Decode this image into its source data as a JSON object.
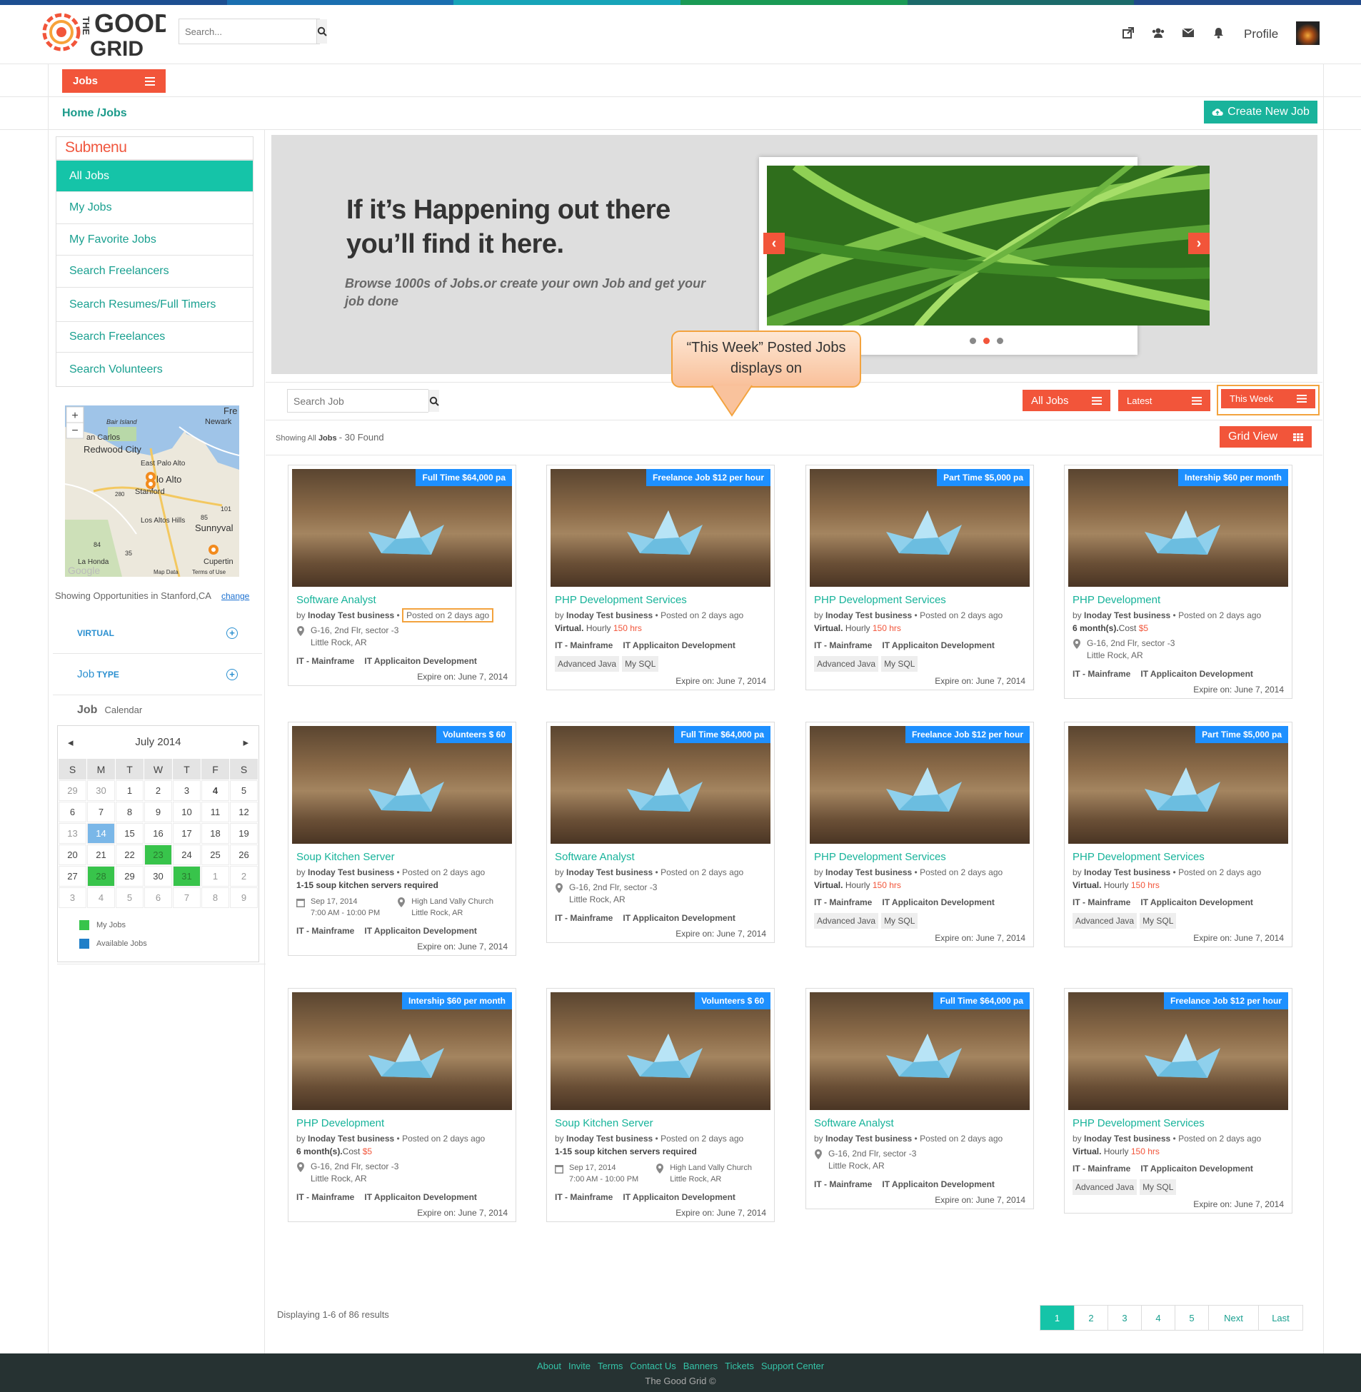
{
  "header": {
    "logo_line1": "THE",
    "logo_line2": "GOOD",
    "logo_line3": "GRID",
    "search_placeholder": "Search...",
    "profile_label": "Profile"
  },
  "jobs_menu_label": "Jobs",
  "breadcrumb": "Home /Jobs",
  "create_button": "Create New Job",
  "submenu": {
    "title": "Submenu",
    "items": [
      "All Jobs",
      "My Jobs",
      "My Favorite Jobs",
      "Search Freelancers",
      "Search Resumes/Full Timers",
      "Search Freelances",
      "Search Volunteers"
    ]
  },
  "map": {
    "labels": [
      "Fre",
      "Newark",
      "Bair Island",
      "an Carlos",
      "Redwood City",
      "East Palo Alto",
      "lo Alto",
      "Stanford",
      "Los Altos Hills",
      "Sunnyval",
      "La Honda",
      "Cupertin",
      "Map Data",
      "Terms of Use",
      "280",
      "101",
      "85",
      "84",
      "35",
      "Google"
    ],
    "zoom_in": "+",
    "zoom_out": "−"
  },
  "opportunities": {
    "text": "Showing Opportunities in Stanford,CA",
    "change": "change"
  },
  "facets": {
    "virtual": "VIRTUAL",
    "job_type_a": "Job",
    "job_type_b": "TYPE",
    "job_calendar_a": "Job",
    "job_calendar_b": "Calendar"
  },
  "calendar": {
    "prev": "◂",
    "next": "▸",
    "month": "July 2014",
    "weekdays": [
      "S",
      "M",
      "T",
      "W",
      "T",
      "F",
      "S"
    ],
    "rows": [
      [
        "29",
        "30",
        "1",
        "2",
        "3",
        "4",
        "5"
      ],
      [
        "6",
        "7",
        "8",
        "9",
        "10",
        "11",
        "12"
      ],
      [
        "13",
        "14",
        "15",
        "16",
        "17",
        "18",
        "19"
      ],
      [
        "20",
        "21",
        "22",
        "23",
        "24",
        "25",
        "26"
      ],
      [
        "27",
        "28",
        "29",
        "30",
        "31",
        "1",
        "2"
      ],
      [
        "3",
        "4",
        "5",
        "6",
        "7",
        "8",
        "9"
      ]
    ],
    "legend_my": "My Jobs",
    "legend_available": "Available Jobs",
    "colors": {
      "my_jobs": "#38c44b",
      "available": "#1f7fc8"
    }
  },
  "banner": {
    "title": "If it’s Happening out there you’ll find it here.",
    "subtitle": "Browse 1000s of Jobs.or create your own Job and get your job done",
    "prev": "‹",
    "next": "›"
  },
  "callout": "“This Week” Posted Jobs displays on",
  "jobs_toolbar": {
    "search_placeholder": "Search Job",
    "all_jobs": "All Jobs",
    "latest": "Latest",
    "this_week": "This Week",
    "showing_prefix": "Showing All",
    "showing_bold": "Jobs",
    "showing_suffix": "- 30 Found",
    "grid_view": "Grid View"
  },
  "cards": [
    {
      "tag": "Full Time $64,000 pa",
      "title": "Software Analyst",
      "by": "by",
      "biz": "Inoday Test business",
      "dot": "•",
      "posted": "Posted on 2  days ago",
      "l1": "G-16, 2nd Flr, sector -3",
      "l2": "Little Rock, AR",
      "c1": "IT - Mainframe",
      "c2": "IT Applicaiton Development",
      "exp": "Expire on: June 7, 2014"
    },
    {
      "tag": "Freelance Job   $12 per hour",
      "title": "PHP Development Services",
      "by": "by",
      "biz": "Inoday Test business",
      "dot": "•",
      "posted": "Posted on 2  days ago",
      "v1": "Virtual.",
      "v2": "Hourly",
      "v3": "150 hrs",
      "c1": "IT - Mainframe",
      "c2": "IT Applicaiton Development",
      "s1": "Advanced Java",
      "s2": "My SQL",
      "exp": "Expire on: June 7, 2014"
    },
    {
      "tag": "Part Time $5,000 pa",
      "title": "PHP Development Services",
      "by": "by",
      "biz": "Inoday Test business",
      "dot": "•",
      "posted": "Posted on 2  days ago",
      "v1": "Virtual.",
      "v2": "Hourly",
      "v3": "150 hrs",
      "c1": "IT - Mainframe",
      "c2": "IT Applicaiton Development",
      "s1": "Advanced Java",
      "s2": "My SQL",
      "exp": "Expire on: June 7, 2014"
    },
    {
      "tag": "Intership $60 per month",
      "title": "PHP Development",
      "by": "by",
      "biz": "Inoday Test business",
      "dot": "•",
      "posted": "Posted on 2  days ago",
      "m1": "6 month(s).",
      "m2": "Cost",
      "m3": "$5",
      "l1": "G-16, 2nd Flr, sector -3",
      "l2": "Little Rock, AR",
      "c1": "IT - Mainframe",
      "c2": "IT Applicaiton Development",
      "exp": "Expire on: June 7, 2014"
    },
    {
      "tag": "Volunteers  $ 60",
      "title": "Soup Kitchen Server",
      "by": "by",
      "biz": "Inoday Test business",
      "dot": "•",
      "posted": "Posted on 2  days ago",
      "k1": "1-15",
      "k2": "soup kitchen servers required",
      "d1": "Sep 17, 2014",
      "d2": "7:00 AM - 10:00 PM",
      "p1": "High Land Vally Church",
      "p2": "Little Rock, AR",
      "c1": "IT - Mainframe",
      "c2": "IT Applicaiton Development",
      "exp": "Expire on: June 7, 2014"
    },
    {
      "tag": "Full Time $64,000 pa",
      "title": "Software Analyst",
      "by": "by",
      "biz": "Inoday Test business",
      "dot": "•",
      "posted": "Posted on 2  days ago",
      "l1": "G-16, 2nd Flr, sector -3",
      "l2": "Little Rock, AR",
      "c1": "IT - Mainframe",
      "c2": "IT Applicaiton Development",
      "exp": "Expire on: June 7, 2014"
    },
    {
      "tag": "Freelance Job   $12 per hour",
      "title": "PHP Development Services",
      "by": "by",
      "biz": "Inoday Test business",
      "dot": "•",
      "posted": "Posted on 2  days ago",
      "v1": "Virtual.",
      "v2": "Hourly",
      "v3": "150 hrs",
      "c1": "IT - Mainframe",
      "c2": "IT Applicaiton Development",
      "s1": "Advanced Java",
      "s2": "My SQL",
      "exp": "Expire on: June 7, 2014"
    },
    {
      "tag": "Part Time $5,000 pa",
      "title": "PHP Development Services",
      "by": "by",
      "biz": "Inoday Test business",
      "dot": "•",
      "posted": "Posted on 2  days ago",
      "v1": "Virtual.",
      "v2": "Hourly",
      "v3": "150 hrs",
      "c1": "IT - Mainframe",
      "c2": "IT Applicaiton Development",
      "s1": "Advanced Java",
      "s2": "My SQL",
      "exp": "Expire on: June 7, 2014"
    },
    {
      "tag": "Intership $60 per month",
      "title": "PHP Development",
      "by": "by",
      "biz": "Inoday Test business",
      "dot": "•",
      "posted": "Posted on 2  days ago",
      "m1": "6 month(s).",
      "m2": "Cost",
      "m3": "$5",
      "l1": "G-16, 2nd Flr, sector -3",
      "l2": "Little Rock, AR",
      "c1": "IT - Mainframe",
      "c2": "IT Applicaiton Development",
      "exp": "Expire on: June 7, 2014"
    },
    {
      "tag": "Volunteers  $ 60",
      "title": "Soup Kitchen Server",
      "by": "by",
      "biz": "Inoday Test business",
      "dot": "•",
      "posted": "Posted on 2  days ago",
      "k1": "1-15",
      "k2": "soup kitchen servers required",
      "d1": "Sep 17, 2014",
      "d2": "7:00 AM - 10:00 PM",
      "p1": "High Land Vally Church",
      "p2": "Little Rock, AR",
      "c1": "IT - Mainframe",
      "c2": "IT Applicaiton Development",
      "exp": "Expire on: June 7, 2014"
    },
    {
      "tag": "Full Time $64,000 pa",
      "title": "Software Analyst",
      "by": "by",
      "biz": "Inoday Test business",
      "dot": "•",
      "posted": "Posted on 2  days ago",
      "l1": "G-16, 2nd Flr, sector -3",
      "l2": "Little Rock, AR",
      "c1": "IT - Mainframe",
      "c2": "IT Applicaiton Development",
      "exp": "Expire on: June 7, 2014"
    },
    {
      "tag": "Freelance Job   $12 per hour",
      "title": "PHP Development Services",
      "by": "by",
      "biz": "Inoday Test business",
      "dot": "•",
      "posted": "Posted on 2  days ago",
      "v1": "Virtual.",
      "v2": "Hourly",
      "v3": "150 hrs",
      "c1": "IT - Mainframe",
      "c2": "IT Applicaiton Development",
      "s1": "Advanced Java",
      "s2": "My SQL",
      "exp": "Expire on: June 7, 2014"
    }
  ],
  "pagination": {
    "displaying": "Displaying 1-6 of 86 results",
    "pages": [
      "1",
      "2",
      "3",
      "4",
      "5",
      "Next",
      "Last"
    ]
  },
  "footer": {
    "links": [
      "About",
      "Invite",
      "Terms",
      "Contact Us",
      "Banners",
      "Tickets",
      "Support Center"
    ],
    "copyright": "The Good Grid ©"
  },
  "colors": {
    "accent_red": "#f2553a",
    "accent_teal": "#15c4a8",
    "tag_blue": "#1e90ff",
    "highlight": "#f3a33e"
  }
}
